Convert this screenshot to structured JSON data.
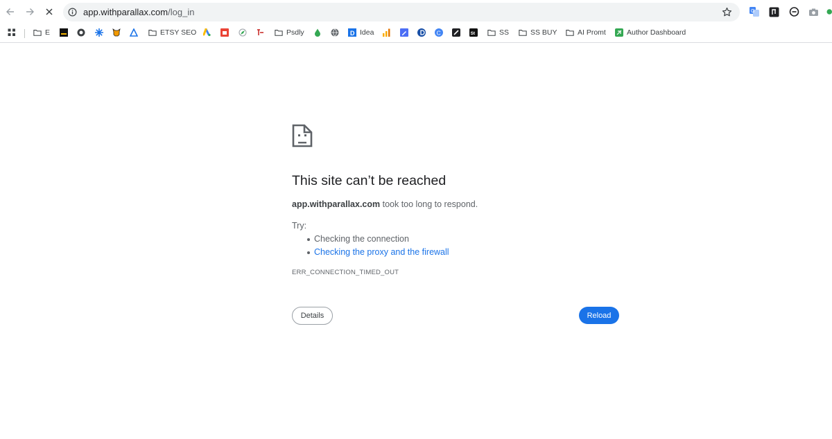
{
  "toolbar": {
    "back_icon": "arrow-left-icon",
    "forward_icon": "arrow-right-icon",
    "stop_icon": "close-icon",
    "omnibox": {
      "host": "app.withparallax.com",
      "path": "/log_in",
      "info_icon": "info-circle-icon",
      "bookmark_icon": "star-icon"
    },
    "extensions": [
      "translate-icon",
      "music-score-icon",
      "chat-bubble-icon",
      "camera-icon",
      "green-status-icon"
    ]
  },
  "bookmarks": [
    {
      "label": "",
      "icon": "apps-grid-icon"
    },
    {
      "label": "E",
      "icon": "folder-icon"
    },
    {
      "label": "",
      "icon": "black-square-icon"
    },
    {
      "label": "",
      "icon": "globe-dark-icon"
    },
    {
      "label": "",
      "icon": "asterisk-icon"
    },
    {
      "label": "",
      "icon": "cow-icon"
    },
    {
      "label": "",
      "icon": "triangle-logo-icon"
    },
    {
      "label": "ETSY SEO",
      "icon": "folder-icon"
    },
    {
      "label": "",
      "icon": "google-ads-icon"
    },
    {
      "label": "",
      "icon": "orange-box-icon"
    },
    {
      "label": "",
      "icon": "compass-icon"
    },
    {
      "label": "",
      "icon": "script-logo-icon"
    },
    {
      "label": "Psdly",
      "icon": "folder-icon"
    },
    {
      "label": "",
      "icon": "drop-icon"
    },
    {
      "label": "",
      "icon": "globe-icon"
    },
    {
      "label": "Idea",
      "icon": "blue-d-icon"
    },
    {
      "label": "",
      "icon": "bar-chart-icon"
    },
    {
      "label": "",
      "icon": "blue-pen-icon"
    },
    {
      "label": "",
      "icon": "navy-circle-icon"
    },
    {
      "label": "",
      "icon": "blue-c-icon"
    },
    {
      "label": "",
      "icon": "black-square-logo-icon"
    },
    {
      "label": "",
      "icon": "st-icon"
    },
    {
      "label": "SS",
      "icon": "folder-icon"
    },
    {
      "label": "SS BUY",
      "icon": "folder-icon"
    },
    {
      "label": "AI Promt",
      "icon": "folder-icon"
    },
    {
      "label": "Author Dashboard",
      "icon": "green-leaf-icon"
    }
  ],
  "error": {
    "icon": "sad-document-icon",
    "title": "This site can’t be reached",
    "host": "app.withparallax.com",
    "description": " took too long to respond.",
    "try_label": "Try:",
    "suggestions": [
      "Checking the connection",
      "Checking the proxy and the firewall"
    ],
    "code": "ERR_CONNECTION_TIMED_OUT",
    "details_label": "Details",
    "reload_label": "Reload"
  },
  "colors": {
    "accent": "#1a73e8",
    "text": "#202124",
    "secondary_text": "#5f6368",
    "omnibox_bg": "#f1f3f4"
  }
}
